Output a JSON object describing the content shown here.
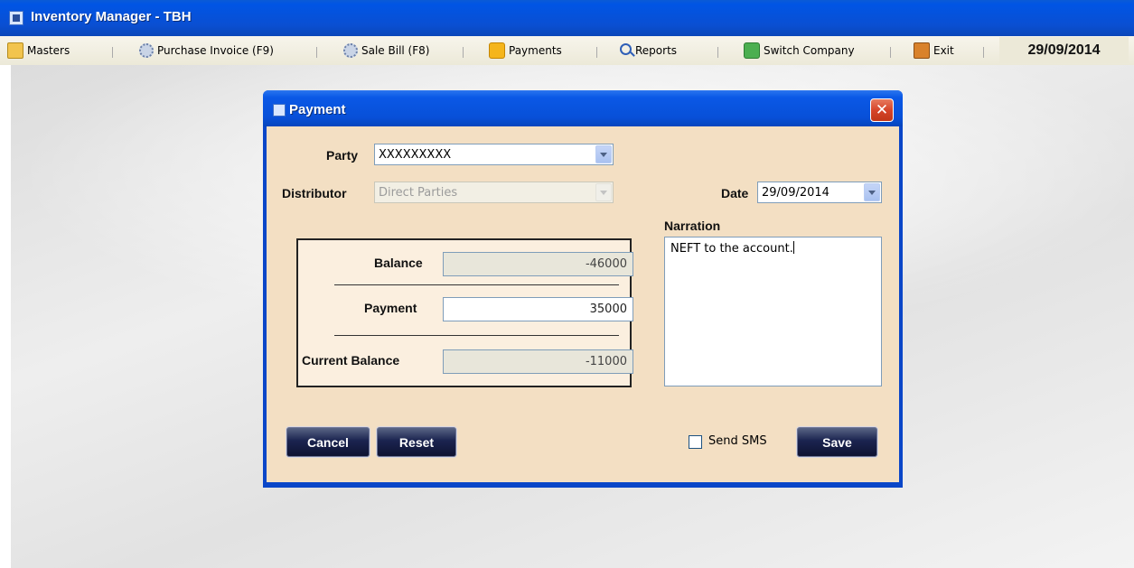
{
  "window": {
    "title": "Inventory Manager - TBH"
  },
  "menubar": {
    "items": [
      {
        "label": "Masters",
        "icon": "folder-icon"
      },
      {
        "label": "Purchase Invoice (F9)",
        "icon": "gear-icon"
      },
      {
        "label": "Sale Bill (F8)",
        "icon": "gear-icon"
      },
      {
        "label": "Payments",
        "icon": "payments-icon"
      },
      {
        "label": "Reports",
        "icon": "search-icon"
      },
      {
        "label": "Switch Company",
        "icon": "switch-company-icon"
      },
      {
        "label": "Exit",
        "icon": "exit-icon"
      }
    ],
    "date": "29/09/2014"
  },
  "dialog": {
    "title": "Payment",
    "close_glyph": "✕",
    "party": {
      "label": "Party",
      "value": "XXXXXXXXX"
    },
    "distributor": {
      "label": "Distributor",
      "value": "Direct Parties"
    },
    "date": {
      "label": "Date",
      "value": "29/09/2014"
    },
    "narration": {
      "label": "Narration",
      "value": "NEFT to the account."
    },
    "balance": {
      "label": "Balance",
      "value": "-46000"
    },
    "payment": {
      "label": "Payment",
      "value": "35000"
    },
    "current_balance": {
      "label": "Current Balance",
      "value": "-11000"
    },
    "buttons": {
      "cancel": "Cancel",
      "reset": "Reset",
      "save": "Save"
    },
    "send_sms": {
      "label": "Send SMS",
      "checked": false
    }
  },
  "colors": {
    "titlebar": "#0a55e0",
    "dialog_body": "#f3dfc3",
    "button_dark": "#1b2450",
    "close_red": "#d6452a"
  }
}
